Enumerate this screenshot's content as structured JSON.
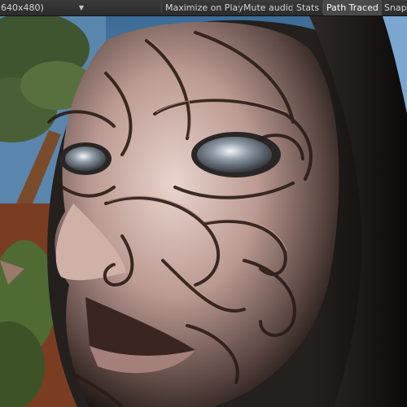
{
  "toolbar": {
    "resolution_label": "640x480)",
    "buttons": [
      {
        "label": "Maximize on Play",
        "active": false
      },
      {
        "label": "Mute audio",
        "active": false
      },
      {
        "label": "Stats",
        "active": false
      },
      {
        "label": "Path Traced",
        "active": true
      },
      {
        "label": "Snaps",
        "active": false
      }
    ],
    "dropdown_icon": "triangle-down"
  },
  "game_view": {
    "image": "rendered portrait of a carved face wearing a dark hood with ornate swirling engraved patterns, desert tree and sky in background"
  },
  "colors": {
    "toolbar_bg": "#2f2f2f",
    "toolbar_text": "#d6d6d6",
    "active_button_bg": "#4a4a4a"
  }
}
